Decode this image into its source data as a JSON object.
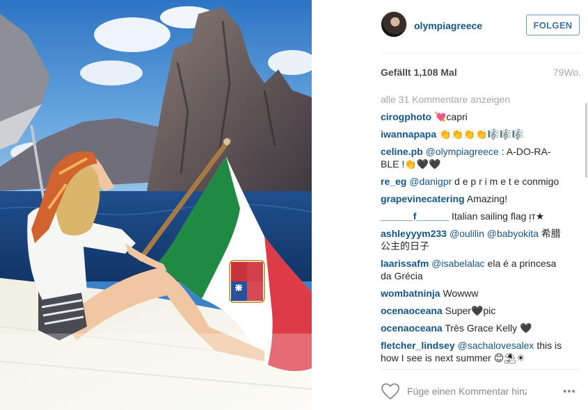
{
  "post": {
    "username": "olympiagreece",
    "follow_label": "FOLGEN",
    "likes": "Gefällt 1,108 Mal",
    "age": "79Wo.",
    "load_all_comments": "alle 31 Kommentare anzeigen",
    "comments": [
      {
        "user": "cirogphoto",
        "mention": "",
        "text": " 💘capri"
      },
      {
        "user": "iwannapapa",
        "mention": "",
        "text": " 👏👏👏👏🎼🎼🎼"
      },
      {
        "user": "celine.pb",
        "mention": "@olympiagreece",
        "text": " : A-DO-RA-BLE !👏🖤🖤"
      },
      {
        "user": "re_eg",
        "mention": "@danigpr",
        "text": " d e p r i m e t e conmigo"
      },
      {
        "user": "grapevinecatering",
        "mention": "",
        "text": " Amazing!"
      },
      {
        "user": "______f______",
        "mention": "",
        "text": " Italian sailing flag ᴉᴛ★"
      },
      {
        "user": "ashleyyym233",
        "mention": "@oulilin @babyokita",
        "text": " 希腊公主的日子"
      },
      {
        "user": "laarissafm",
        "mention": "@isabelalac",
        "text": " ela é a princesa da Grécia"
      },
      {
        "user": "wombatninja",
        "mention": "",
        "text": " Wowww"
      },
      {
        "user": "ocenaoceana",
        "mention": "",
        "text": " Super🖤pic"
      },
      {
        "user": "ocenaoceana",
        "mention": "",
        "text": " Très Grace Kelly 🖤"
      },
      {
        "user": "fletcher_lindsey",
        "mention": "@sachalovesalex",
        "text": " this is how I see is next summer 😊⛱☀"
      }
    ],
    "comment_placeholder": "Füge einen Kommentar hinzu...",
    "more_label": "•••"
  },
  "icons": {
    "like": "heart-outline-icon",
    "options": "ellipsis-icon"
  },
  "colors": {
    "link": "#125688",
    "follow_border": "#6f97b6",
    "muted": "#a5a7aa"
  }
}
